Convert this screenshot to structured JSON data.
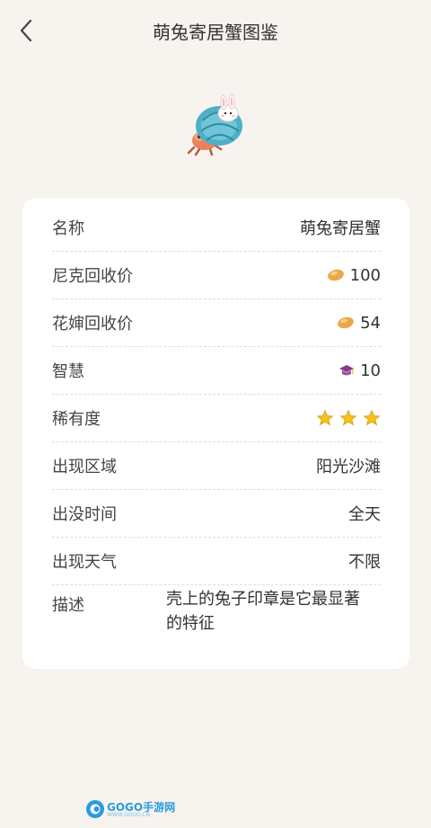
{
  "header": {
    "title": "萌兔寄居蟹图鉴"
  },
  "hero": {
    "icon": "bunny-hermit-crab-icon"
  },
  "details": {
    "name": {
      "label": "名称",
      "value": "萌兔寄居蟹"
    },
    "nick_price": {
      "label": "尼克回收价",
      "value": "100",
      "icon": "bean-icon"
    },
    "huakun_price": {
      "label": "花婶回收价",
      "value": "54",
      "icon": "bean-icon"
    },
    "wisdom": {
      "label": "智慧",
      "value": "10",
      "icon": "graduation-cap-icon"
    },
    "rarity": {
      "label": "稀有度",
      "stars": 3
    },
    "area": {
      "label": "出现区域",
      "value": "阳光沙滩"
    },
    "time": {
      "label": "出没时间",
      "value": "全天"
    },
    "weather": {
      "label": "出现天气",
      "value": "不限"
    },
    "description": {
      "label": "描述",
      "value": "壳上的兔子印章是它最显著的特征"
    }
  },
  "watermark": {
    "brand": "GOGO手游网",
    "url": "WWW.GOGO.CN"
  },
  "colors": {
    "background": "#f7f4ef",
    "card": "#ffffff",
    "bean": "#e8a84a",
    "star": "#f5c21b",
    "cap": "#8a3a8a"
  }
}
